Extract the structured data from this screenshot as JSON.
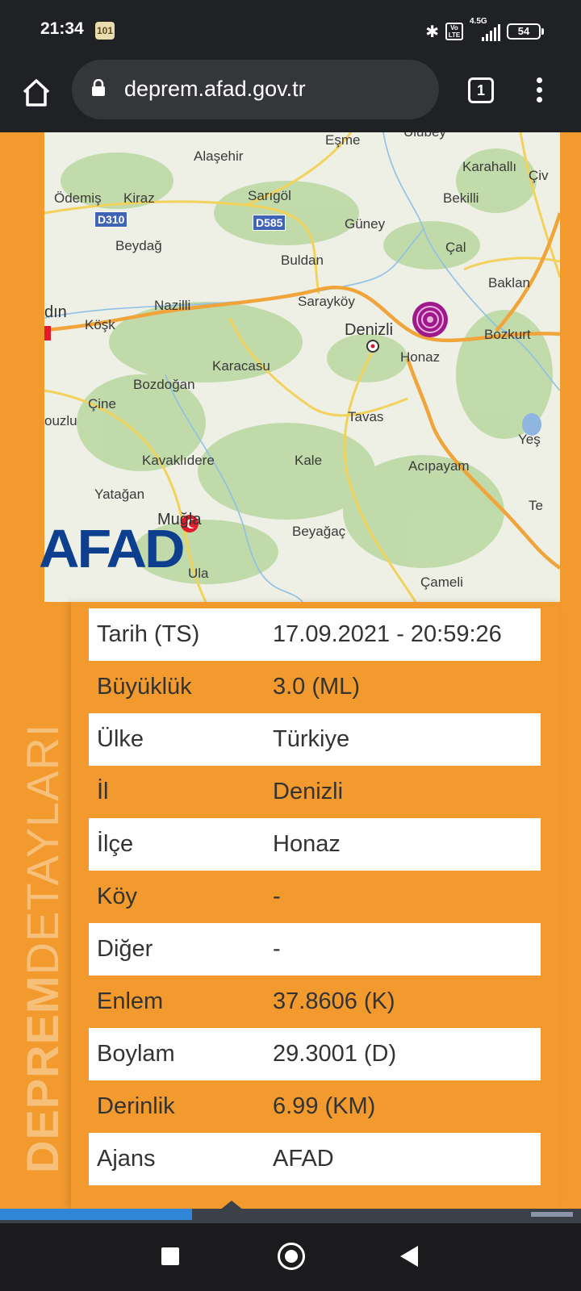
{
  "status_bar": {
    "time": "21:34",
    "notification_badge": "101",
    "network": "4.5G",
    "battery": "54"
  },
  "browser": {
    "url": "deprem.afad.gov.tr",
    "tab_count": "1"
  },
  "map": {
    "places": [
      "Eşme",
      "Ulubey",
      "Alaşehir",
      "Karahallı",
      "Çiv",
      "Ödemiş",
      "Kiraz",
      "Sarıgöl",
      "Bekilli",
      "Güney",
      "Beydağ",
      "Çal",
      "Buldan",
      "Baklan",
      "dın",
      "Köşk",
      "Nazilli",
      "Sarayköy",
      "Denizli",
      "Bozkurt",
      "Honaz",
      "Karacasu",
      "Bozdoğan",
      "Çine",
      "ouzlu",
      "Tavas",
      "Yeş",
      "Kavaklıdere",
      "Kale",
      "Acıpayam",
      "Yatağan",
      "Te",
      "Muğla",
      "Beyağaç",
      "Ula",
      "Çameli"
    ],
    "road_shields": [
      "D310",
      "D585"
    ],
    "logo": "AFAD",
    "epicenter_color": "#a0198c"
  },
  "side_title": {
    "bold": "DEPREM",
    "light": "DETAYLARI"
  },
  "details": [
    {
      "key": "Tarih (TS)",
      "value": "17.09.2021 - 20:59:26"
    },
    {
      "key": "Büyüklük",
      "value": "3.0 (ML)"
    },
    {
      "key": "Ülke",
      "value": "Türkiye"
    },
    {
      "key": "İl",
      "value": "Denizli"
    },
    {
      "key": "İlçe",
      "value": "Honaz"
    },
    {
      "key": "Köy",
      "value": "-"
    },
    {
      "key": "Diğer",
      "value": "-"
    },
    {
      "key": "Enlem",
      "value": "37.8606 (K)"
    },
    {
      "key": "Boylam",
      "value": "29.3001 (D)"
    },
    {
      "key": "Derinlik",
      "value": "6.99 (KM)"
    },
    {
      "key": "Ajans",
      "value": "AFAD"
    }
  ],
  "page_progress": 0.33
}
